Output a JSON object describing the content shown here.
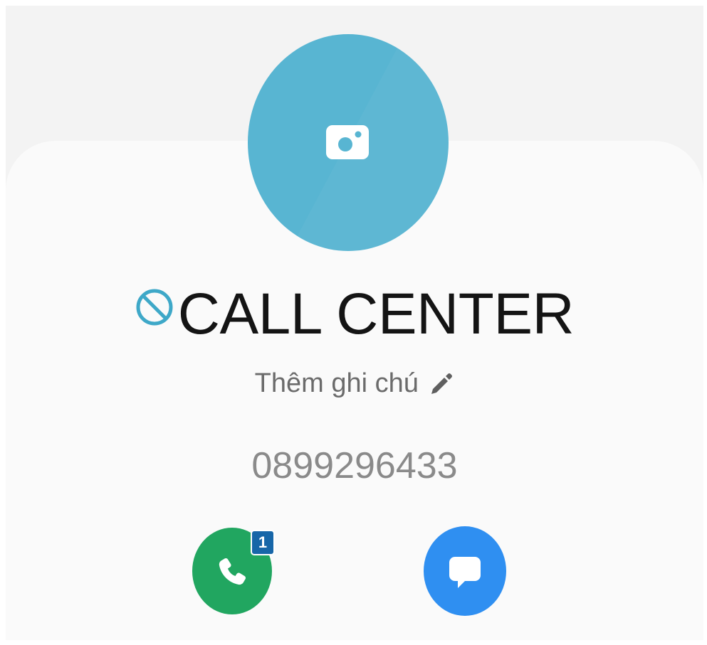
{
  "contact": {
    "name": "CALL CENTER",
    "note_placeholder": "Thêm ghi chú",
    "phone_number": "0899296433",
    "call_badge_count": "1"
  },
  "icons": {
    "avatar": "camera-icon",
    "blocked": "blocked-icon",
    "note": "pencil-icon",
    "call": "phone-icon",
    "message": "message-icon"
  },
  "colors": {
    "avatar": "#58b5d2",
    "call_button": "#21a660",
    "message_button": "#2f8ff1",
    "badge": "#1766a8"
  }
}
